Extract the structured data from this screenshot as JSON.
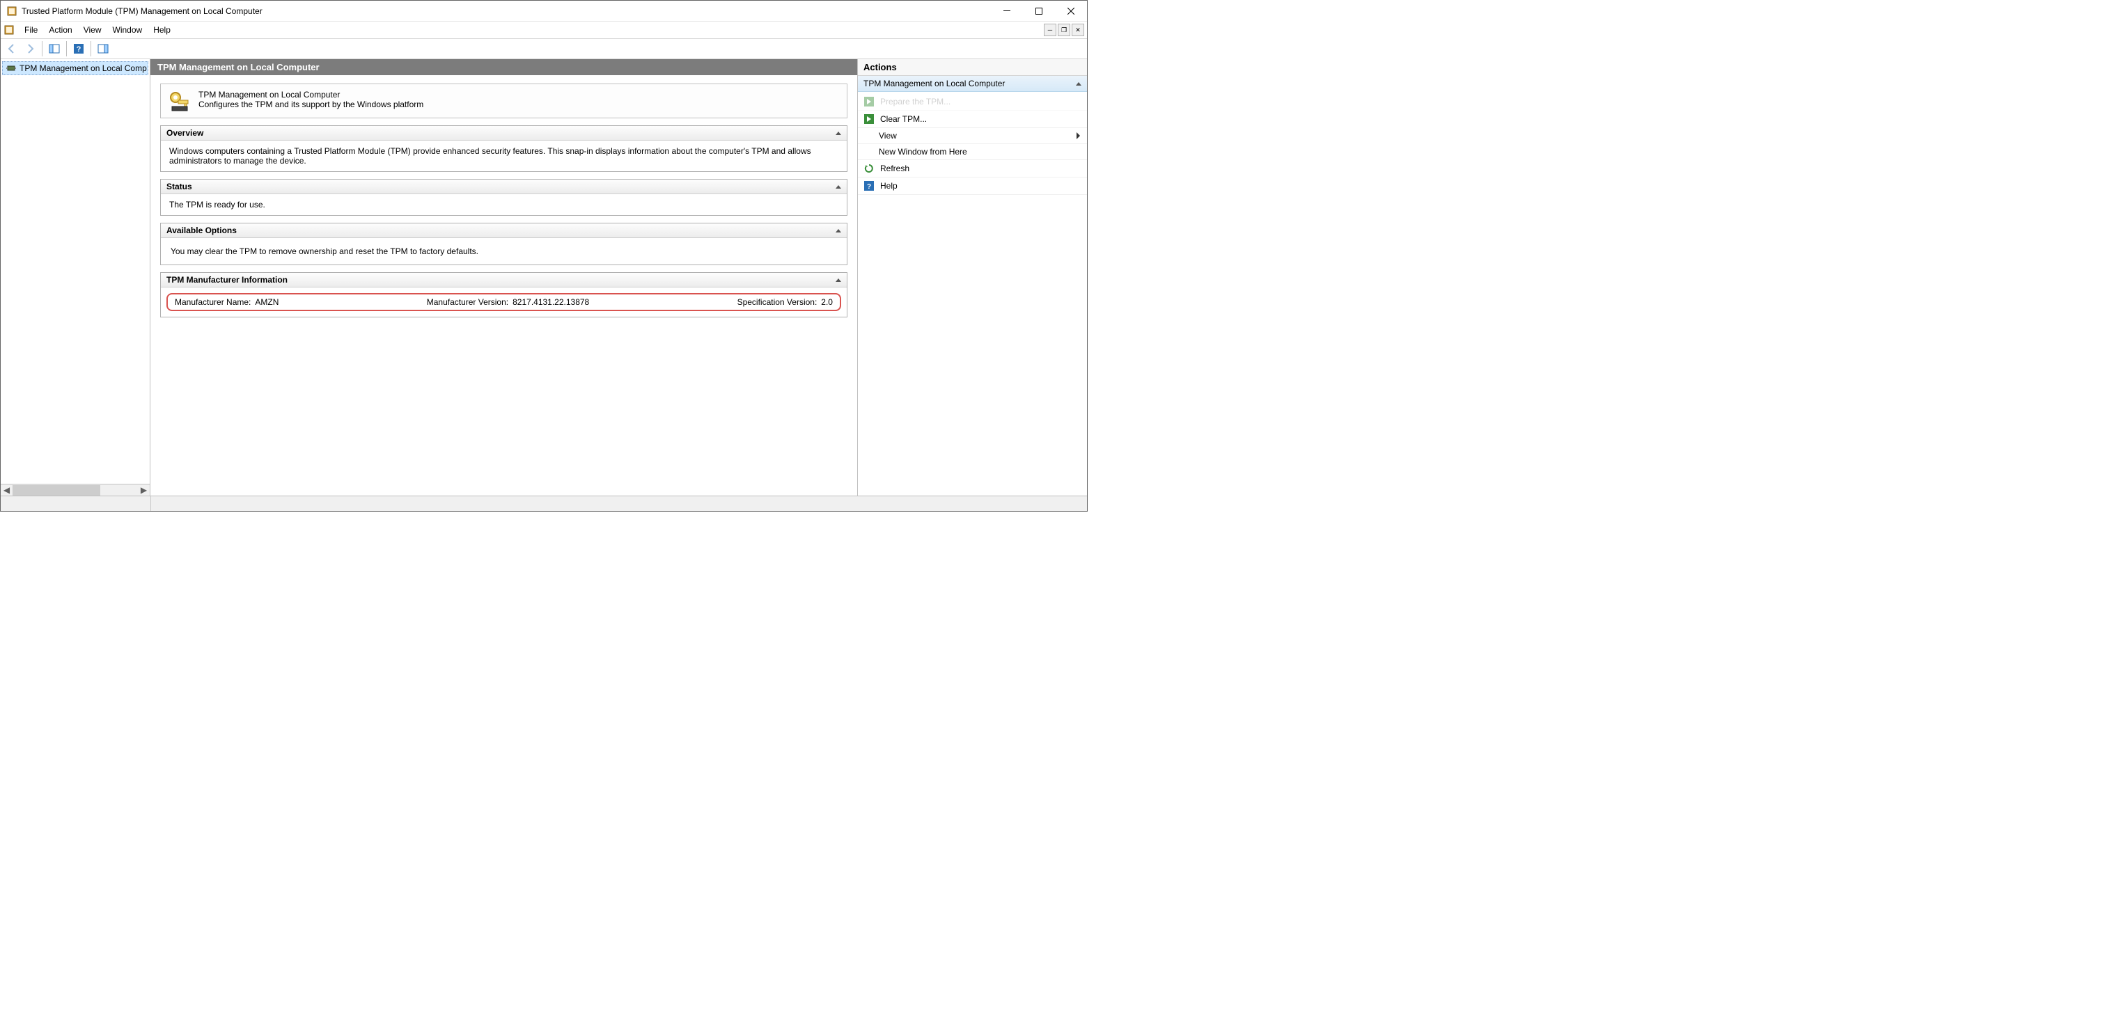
{
  "window": {
    "title": "Trusted Platform Module (TPM) Management on Local Computer"
  },
  "menubar": {
    "items": [
      "File",
      "Action",
      "View",
      "Window",
      "Help"
    ]
  },
  "tree": {
    "node_label": "TPM Management on Local Comp"
  },
  "center": {
    "header": "TPM Management on Local Computer",
    "intro_title": "TPM Management on Local Computer",
    "intro_desc": "Configures the TPM and its support by the Windows platform",
    "sections": {
      "overview": {
        "title": "Overview",
        "body": "Windows computers containing a Trusted Platform Module (TPM) provide enhanced security features. This snap-in displays information about the computer's TPM and allows administrators to manage the device."
      },
      "status": {
        "title": "Status",
        "body": "The TPM is ready for use."
      },
      "options": {
        "title": "Available Options",
        "body": "You may clear the TPM to remove ownership and reset the TPM to factory defaults."
      },
      "manufacturer": {
        "title": "TPM Manufacturer Information",
        "name_label": "Manufacturer Name:",
        "name_value": "AMZN",
        "version_label": "Manufacturer Version:",
        "version_value": "8217.4131.22.13878",
        "spec_label": "Specification Version:",
        "spec_value": "2.0"
      }
    }
  },
  "actions": {
    "header": "Actions",
    "group": "TPM Management on Local Computer",
    "items": {
      "prepare": "Prepare the TPM...",
      "clear": "Clear TPM...",
      "view": "View",
      "new_window": "New Window from Here",
      "refresh": "Refresh",
      "help": "Help"
    }
  }
}
